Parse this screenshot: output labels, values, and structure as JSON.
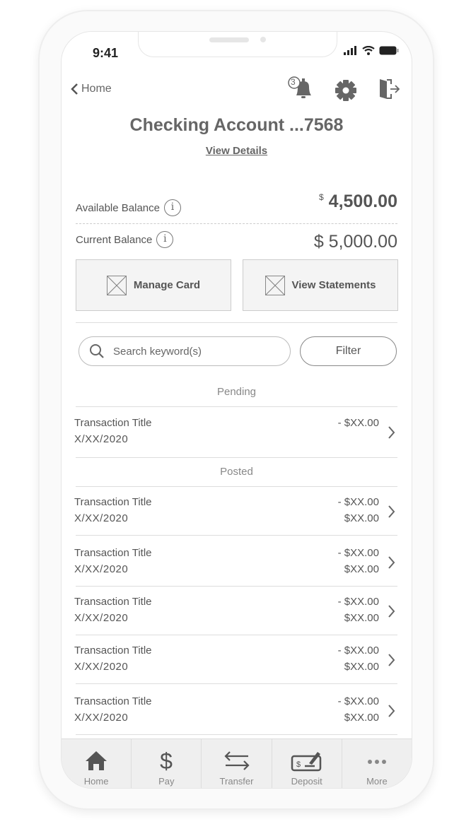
{
  "status": {
    "time": "9:41"
  },
  "header": {
    "back_label": "Home",
    "notification_count": "3",
    "title": "Checking Account ...7568",
    "view_details": "View Details"
  },
  "balances": {
    "available_label": "Available Balance",
    "available_currency": "$",
    "available_amount": "4,500.00",
    "current_label": "Current Balance",
    "current_amount": "$ 5,000.00"
  },
  "actions": {
    "manage_card": "Manage Card",
    "view_statements": "View Statements"
  },
  "search": {
    "placeholder": "Search keyword(s)",
    "filter_label": "Filter"
  },
  "sections": {
    "pending": "Pending",
    "posted": "Posted"
  },
  "pending": [
    {
      "title": "Transaction Title",
      "date": "X/XX/2020",
      "amount": "- $XX.00"
    }
  ],
  "posted": [
    {
      "title": "Transaction Title",
      "date": "X/XX/2020",
      "amount": "- $XX.00",
      "balance": "$XX.00"
    },
    {
      "title": "Transaction Title",
      "date": "X/XX/2020",
      "amount": "- $XX.00",
      "balance": "$XX.00"
    },
    {
      "title": "Transaction Title",
      "date": "X/XX/2020",
      "amount": "- $XX.00",
      "balance": "$XX.00"
    },
    {
      "title": "Transaction Title",
      "date": "X/XX/2020",
      "amount": "- $XX.00",
      "balance": "$XX.00"
    },
    {
      "title": "Transaction Title",
      "date": "X/XX/2020",
      "amount": "- $XX.00",
      "balance": "$XX.00"
    }
  ],
  "tabs": [
    {
      "label": "Home",
      "icon": "home-icon"
    },
    {
      "label": "Pay",
      "icon": "dollar-icon"
    },
    {
      "label": "Transfer",
      "icon": "transfer-icon"
    },
    {
      "label": "Deposit",
      "icon": "check-deposit-icon"
    },
    {
      "label": "More",
      "icon": "more-icon"
    }
  ]
}
